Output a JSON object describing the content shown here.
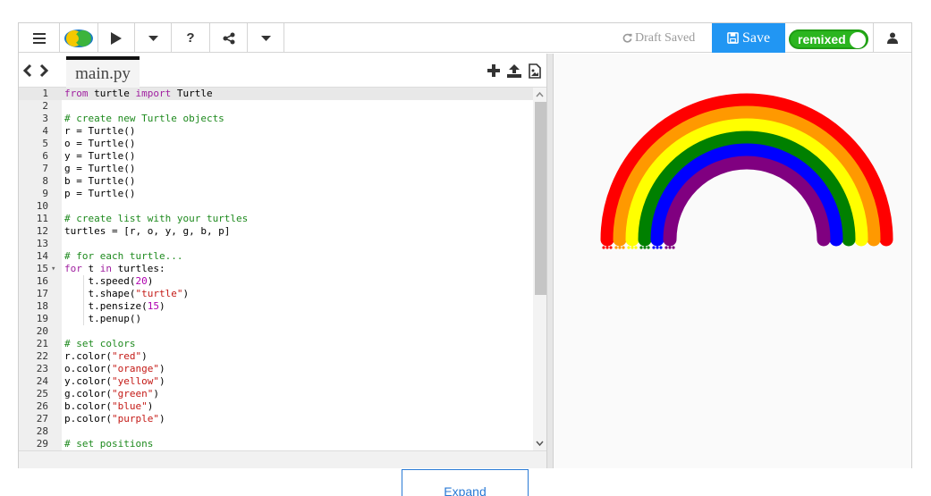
{
  "toolbar": {
    "menu_icon": "hamburger-icon",
    "logo_icon": "trinket-logo-icon",
    "run_icon": "play-icon",
    "run_menu_icon": "caret-down-icon",
    "help_label": "?",
    "share_icon": "share-icon",
    "more_icon": "caret-down-icon",
    "draft_status": "Draft Saved",
    "save_label": "Save",
    "remix_label": "remixed",
    "user_icon": "user-icon"
  },
  "editor": {
    "tab_label": "main.py",
    "nav_icon": "code-arrows-icon",
    "add_icon": "plus-icon",
    "upload_icon": "upload-icon",
    "image_icon": "image-file-icon",
    "lines": [
      {
        "n": "1",
        "fold": "",
        "t": "from turtle import Turtle"
      },
      {
        "n": "2",
        "fold": "",
        "t": ""
      },
      {
        "n": "3",
        "fold": "",
        "t": "# create new Turtle objects"
      },
      {
        "n": "4",
        "fold": "",
        "t": "r = Turtle()"
      },
      {
        "n": "5",
        "fold": "",
        "t": "o = Turtle()"
      },
      {
        "n": "6",
        "fold": "",
        "t": "y = Turtle()"
      },
      {
        "n": "7",
        "fold": "",
        "t": "g = Turtle()"
      },
      {
        "n": "8",
        "fold": "",
        "t": "b = Turtle()"
      },
      {
        "n": "9",
        "fold": "",
        "t": "p = Turtle()"
      },
      {
        "n": "10",
        "fold": "",
        "t": ""
      },
      {
        "n": "11",
        "fold": "",
        "t": "# create list with your turtles"
      },
      {
        "n": "12",
        "fold": "",
        "t": "turtles = [r, o, y, g, b, p]"
      },
      {
        "n": "13",
        "fold": "",
        "t": ""
      },
      {
        "n": "14",
        "fold": "",
        "t": "# for each turtle..."
      },
      {
        "n": "15",
        "fold": "▾",
        "t": "for t in turtles:"
      },
      {
        "n": "16",
        "fold": "",
        "t": "    t.speed(20)"
      },
      {
        "n": "17",
        "fold": "",
        "t": "    t.shape(\"turtle\")"
      },
      {
        "n": "18",
        "fold": "",
        "t": "    t.pensize(15)"
      },
      {
        "n": "19",
        "fold": "",
        "t": "    t.penup()"
      },
      {
        "n": "20",
        "fold": "",
        "t": ""
      },
      {
        "n": "21",
        "fold": "",
        "t": "# set colors"
      },
      {
        "n": "22",
        "fold": "",
        "t": "r.color(\"red\")"
      },
      {
        "n": "23",
        "fold": "",
        "t": "o.color(\"orange\")"
      },
      {
        "n": "24",
        "fold": "",
        "t": "y.color(\"yellow\")"
      },
      {
        "n": "25",
        "fold": "",
        "t": "g.color(\"green\")"
      },
      {
        "n": "26",
        "fold": "",
        "t": "b.color(\"blue\")"
      },
      {
        "n": "27",
        "fold": "",
        "t": "p.color(\"purple\")"
      },
      {
        "n": "28",
        "fold": "",
        "t": ""
      },
      {
        "n": "29",
        "fold": "",
        "t": "# set positions"
      }
    ]
  },
  "output": {
    "rainbow_colors": [
      "#ff0000",
      "#ff9900",
      "#ffff00",
      "#008000",
      "#0000ff",
      "#800080"
    ]
  },
  "below_tab": {
    "label": "Expand"
  },
  "colors": {
    "save_bg": "#2196f3",
    "remix_bg": "#2bb51f",
    "comment": "#1e8a1e",
    "keyword": "#a020a0",
    "string": "#c41a16"
  }
}
